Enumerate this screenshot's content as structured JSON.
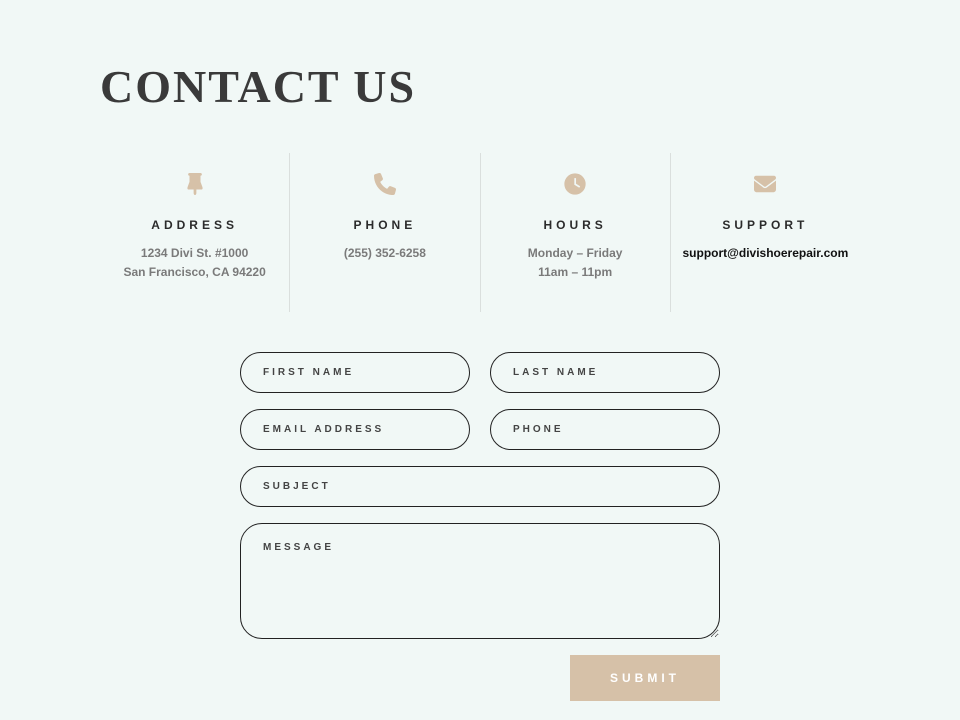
{
  "header": {
    "title": "CONTACT US"
  },
  "info": {
    "address": {
      "heading": "ADDRESS",
      "line1": "1234 Divi St. #1000",
      "line2": "San Francisco, CA 94220"
    },
    "phone": {
      "heading": "PHONE",
      "value": "(255) 352-6258"
    },
    "hours": {
      "heading": "HOURS",
      "line1": "Monday – Friday",
      "line2": "11am – 11pm"
    },
    "support": {
      "heading": "SUPPORT",
      "email": "support@divishoerepair.com"
    }
  },
  "form": {
    "first_name_placeholder": "FIRST NAME",
    "last_name_placeholder": "LAST NAME",
    "email_placeholder": "EMAIL ADDRESS",
    "phone_placeholder": "PHONE",
    "subject_placeholder": "SUBJECT",
    "message_placeholder": "MESSAGE",
    "submit_label": "SUBMIT"
  },
  "colors": {
    "accent": "#d6c1a8",
    "bg": "#f1f8f6"
  }
}
